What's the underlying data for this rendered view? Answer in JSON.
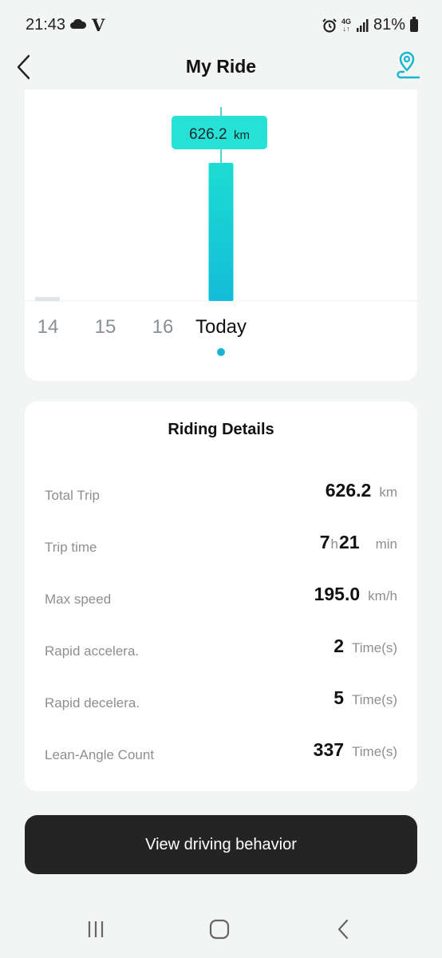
{
  "status_bar": {
    "time": "21:43",
    "carrier_glyph": "V",
    "network": "4G",
    "battery": "81%"
  },
  "header": {
    "title": "My Ride",
    "back_icon": "chevron-left-icon",
    "route_icon": "route-pin-icon"
  },
  "chart": {
    "tooltip_value": "626.2",
    "tooltip_unit": "km",
    "day_labels": [
      "14",
      "15",
      "16",
      "Today"
    ],
    "active_index": 3
  },
  "chart_data": {
    "type": "bar",
    "categories": [
      "14",
      "15",
      "16",
      "Today"
    ],
    "values": [
      0,
      0,
      0,
      626.2
    ],
    "ylabel": "",
    "xlabel": "",
    "colors": {
      "bar": "#19d6d4",
      "bar_bottom": "#14bcd8",
      "tooltip": "#27e0d6",
      "inactive_bar": "#dde6e6"
    }
  },
  "details": {
    "title": "Riding Details",
    "rows": [
      {
        "label": "Total Trip",
        "value": "626.2",
        "unit": "km"
      },
      {
        "label": "Trip time",
        "hours": "7",
        "hours_unit": "h",
        "minutes": "21",
        "unit": "min"
      },
      {
        "label": "Max speed",
        "value": "195.0",
        "unit": "km/h"
      },
      {
        "label": "Rapid accelera.",
        "value": "2",
        "unit": "Time(s)"
      },
      {
        "label": "Rapid decelera.",
        "value": "5",
        "unit": "Time(s)"
      },
      {
        "label": "Lean-Angle Count",
        "value": "337",
        "unit": "Time(s)"
      }
    ]
  },
  "action": {
    "label": "View driving behavior"
  },
  "nav": {
    "recent_icon": "recent-apps-icon",
    "home_icon": "home-icon",
    "back_icon": "back-icon"
  }
}
